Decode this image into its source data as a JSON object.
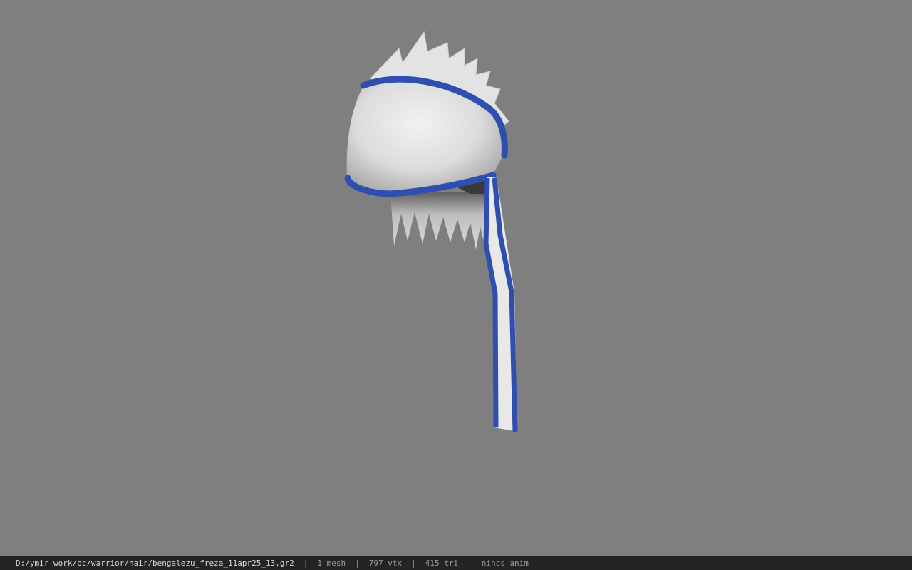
{
  "viewport": {
    "background_color": "#7f7f7f",
    "model_colors": {
      "hair": "#e6e6e6",
      "band": "#2f4fb0"
    }
  },
  "statusbar": {
    "file_path": "D:/ymir work/pc/warrior/hair/bengalezu_freza_11apr25_13.gr2",
    "separator": "|",
    "mesh_count": "1 mesh",
    "vertex_count": "797 vtx",
    "triangle_count": "415 tri",
    "anim_status": "nincs anim"
  }
}
